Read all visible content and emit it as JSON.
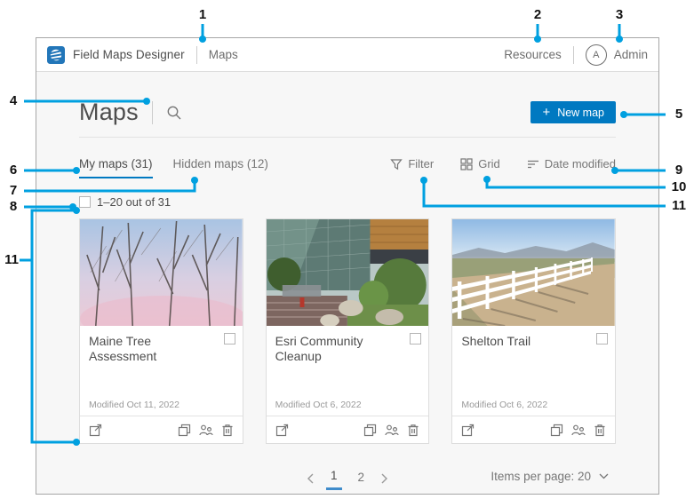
{
  "colors": {
    "accent": "#0079c1",
    "callout_line": "#00a0e0"
  },
  "header": {
    "brand": "Field Maps Designer",
    "nav_maps": "Maps",
    "resources": "Resources",
    "avatar_initial": "A",
    "user_name": "Admin"
  },
  "page": {
    "title": "Maps",
    "new_map_plus": "+",
    "new_map_label": "New map"
  },
  "tabs": {
    "my_maps": "My maps (31)",
    "hidden_maps": "Hidden maps (12)"
  },
  "view_controls": {
    "filter": "Filter",
    "grid": "Grid",
    "sort": "Date modified"
  },
  "selection": {
    "range_label": "1–20 out of 31"
  },
  "cards": [
    {
      "title": "Maine Tree Assessment",
      "modified": "Modified Oct 11, 2022"
    },
    {
      "title": "Esri Community Cleanup",
      "modified": "Modified Oct 6, 2022"
    },
    {
      "title": "Shelton Trail",
      "modified": "Modified Oct 6, 2022"
    }
  ],
  "pagination": {
    "page_1": "1",
    "page_2": "2",
    "items_per_page": "Items per page: 20"
  },
  "callouts": {
    "c1": "1",
    "c2": "2",
    "c3": "3",
    "c4": "4",
    "c5": "5",
    "c6": "6",
    "c7": "7",
    "c8": "8",
    "c9": "9",
    "c10": "10",
    "c11": "11"
  }
}
